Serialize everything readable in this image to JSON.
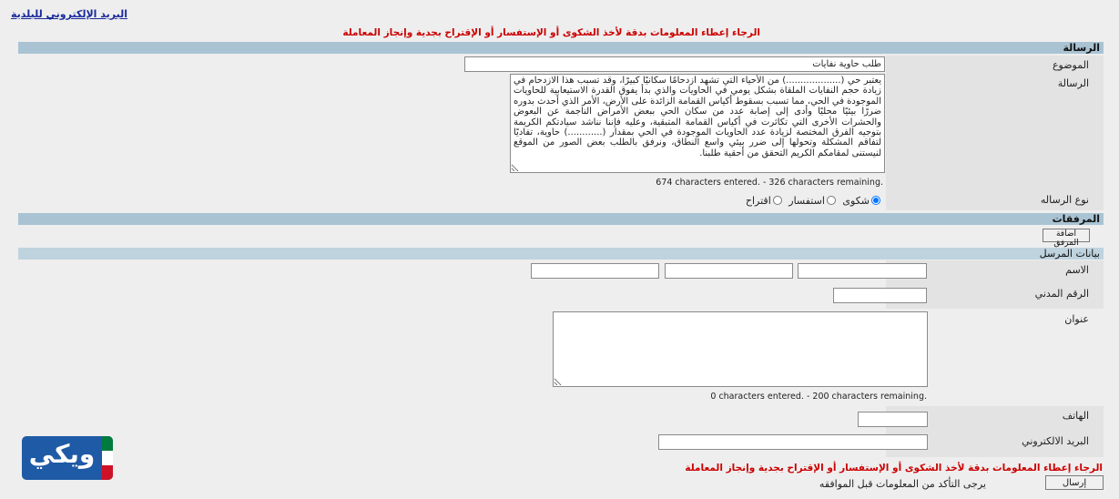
{
  "header": {
    "email_link": "البريد الإلكتروني للبلدية",
    "notice_top": "الرجاء إعطاء المعلومات بدقة لأخذ الشكوى أو الإستفسار أو الإقتراح بجدية وإنجاز المعاملة"
  },
  "message_section": {
    "title": "الرسالة",
    "subject_label": "الموضوع",
    "subject_value": "طلب حاوية نفايات",
    "message_label": "الرسالة",
    "message_value": "يعتبر حي (...................) من الأحياء التي تشهد ازدحامًا سكانيًا كبيرًا، وقد تسبب هذا الازدحام في زيادة حجم النفايات الملقاة بشكل يومي في الحاويات والذي بدأ يفوق القدرة الاستيعابية للحاويات الموجودة في الحي، مما تسبب بسقوط أكياس القمامة الزائدة على الأرض، الأمر الذي أحدث بدوره ضررًا بيئيًا محليًا وأدى إلى إصابة عدد من سكان الحي ببعض الأمراض الناجمة عن البعوض والحشرات الأخرى التي تكاثرت في أكياس القمامة المتبقية، وعليه فإننا نناشد سيادتكم الكريمة بتوجيه الفرق المختصة لزيادة عدد الحاويات الموجودة في الحي بمقدار (............) حاوية، تفاديًا لتفاقم المشكلة وتحولها إلى ضرر بيئي واسع النطاق، ونرفق بالطلب بعض الصور من الموقع لنيستنى لمقامكم الكريم التحقق من أحقية طلبنا.",
    "message_counter": "674 characters entered. - 326 characters remaining.",
    "type_label": "نوع الرساله",
    "types": [
      {
        "label": "شكوى",
        "checked": true
      },
      {
        "label": "استفسار",
        "checked": false
      },
      {
        "label": "اقتراح",
        "checked": false
      }
    ]
  },
  "attachments_section": {
    "title": "المرفقات",
    "add_button": "اضافة المرفق"
  },
  "sender_section": {
    "title": "بيانات المرسل",
    "name_label": "الاسم",
    "civil_id_label": "الرقم المدني",
    "address_label": "عنوان",
    "address_counter": "0 characters entered. - 200 characters remaining.",
    "phone_label": "الهاتف",
    "email_label": "البريد الالكتروني"
  },
  "footer": {
    "notice_bottom": "الرجاء إعطاء المعلومات بدقة لأخذ الشكوى أو الإستفسار أو الإقتراح بجدية وإنجاز المعاملة",
    "send_button": "إرسال",
    "consent_text": "يرجى التأكد من المعلومات قبل الموافقه"
  },
  "watermark": {
    "text": "ويكي",
    "flag_colors": [
      "#007a3d",
      "#ffffff",
      "#ce1126"
    ],
    "bg_color": "#1f5aa6"
  }
}
